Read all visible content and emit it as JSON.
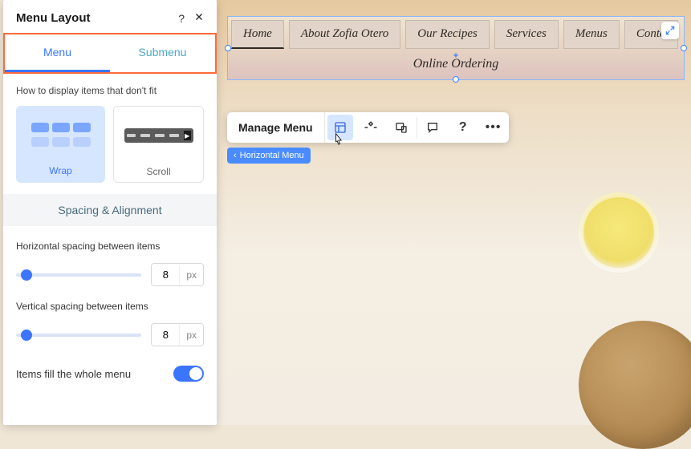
{
  "panel": {
    "title": "Menu Layout",
    "tabs": {
      "menu": "Menu",
      "submenu": "Submenu"
    },
    "hint": "How to display items that don't fit",
    "modes": {
      "wrap": "Wrap",
      "scroll": "Scroll"
    },
    "section": "Spacing & Alignment",
    "h_spacing_label": "Horizontal spacing between items",
    "h_spacing_value": "8",
    "h_spacing_unit": "px",
    "v_spacing_label": "Vertical spacing between items",
    "v_spacing_value": "8",
    "v_spacing_unit": "px",
    "fill_label": "Items fill the whole menu"
  },
  "toolbar": {
    "manage": "Manage Menu"
  },
  "breadcrumb": {
    "label": "Horizontal Menu"
  },
  "nav": {
    "items": [
      "Home",
      "About Zofia Otero",
      "Our Recipes",
      "Services",
      "Menus",
      "Conta"
    ],
    "secondary": "Online Ordering"
  }
}
